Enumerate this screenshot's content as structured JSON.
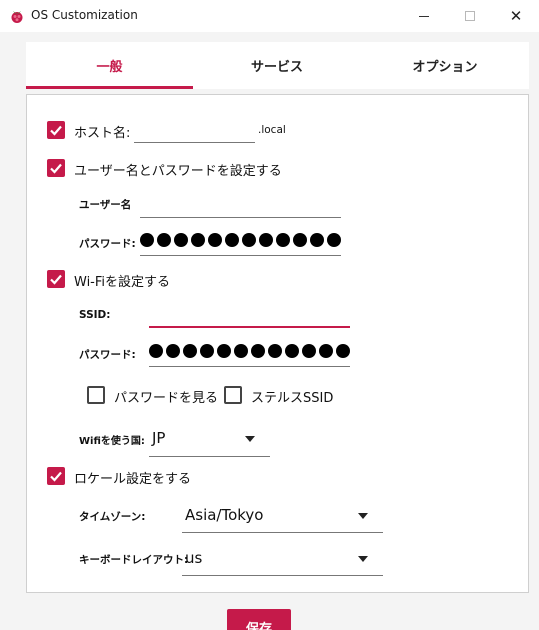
{
  "window": {
    "title": "OS Customization",
    "icon": "raspberry-pi-icon",
    "close_glyph": "✕"
  },
  "tabs": [
    {
      "label": "一般",
      "active": true
    },
    {
      "label": "サービス",
      "active": false
    },
    {
      "label": "オプション",
      "active": false
    }
  ],
  "general": {
    "hostname": {
      "checked": true,
      "label": "ホスト名:",
      "value": "",
      "suffix": ".local"
    },
    "user": {
      "checked": true,
      "label": "ユーザー名とパスワードを設定する",
      "username_label": "ユーザー名",
      "username_value": "",
      "password_label": "パスワード:",
      "password_dots": 14
    },
    "wifi": {
      "checked": true,
      "label": "Wi-Fiを設定する",
      "ssid_label": "SSID:",
      "ssid_value": "",
      "password_label": "パスワード:",
      "password_dots": 14,
      "show_password": {
        "checked": false,
        "label": "パスワードを見る"
      },
      "hidden_ssid": {
        "checked": false,
        "label": "ステルスSSID"
      },
      "country_label": "Wifiを使う国:",
      "country_value": "JP"
    },
    "locale": {
      "checked": true,
      "label": "ロケール設定をする",
      "timezone_label": "タイムゾーン:",
      "timezone_value": "Asia/Tokyo",
      "keyboard_label": "キーボードレイアウト:",
      "keyboard_value": "us"
    }
  },
  "actions": {
    "save_label": "保存"
  },
  "colors": {
    "accent": "#c51a4a",
    "card_border": "#cfcfcf",
    "background": "#f4f4f4"
  }
}
